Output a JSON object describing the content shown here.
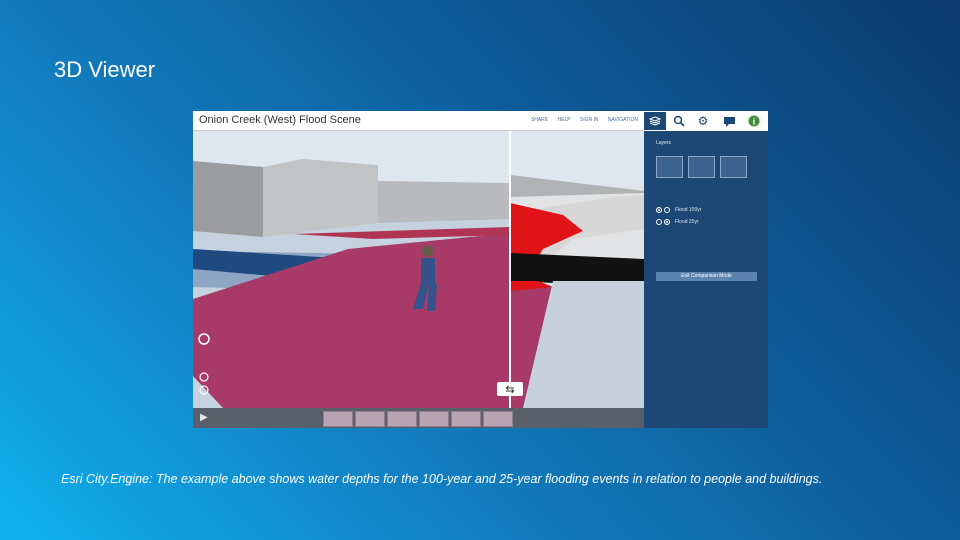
{
  "slide": {
    "title": "3D Viewer",
    "caption": "Esri City.Engine: The example above shows water depths for the 100-year and 25-year flooding events in relation to people and buildings."
  },
  "viewer": {
    "scene_title": "Onion Creek (West) Flood Scene",
    "menu_items": [
      "SHARE",
      "HELP",
      "SIGN IN",
      "NAVIGATION"
    ],
    "tools": [
      "layers-icon",
      "search-icon",
      "gear-icon",
      "comment-icon",
      "info-icon"
    ],
    "panel": {
      "heading": "Layers",
      "buildings": [
        "building-icon",
        "building-icon",
        "building-icon"
      ],
      "options": [
        {
          "label": "Flood 100yr",
          "left": true,
          "right": false
        },
        {
          "label": "Flood 25yr",
          "left": false,
          "right": true
        }
      ],
      "exit_label": "Exit Comparison Mode"
    },
    "timeline_slide_count": 6
  },
  "colors": {
    "flood_pink": "#a73a66",
    "flood_red": "#e01418",
    "panel_blue": "#1d4775"
  }
}
